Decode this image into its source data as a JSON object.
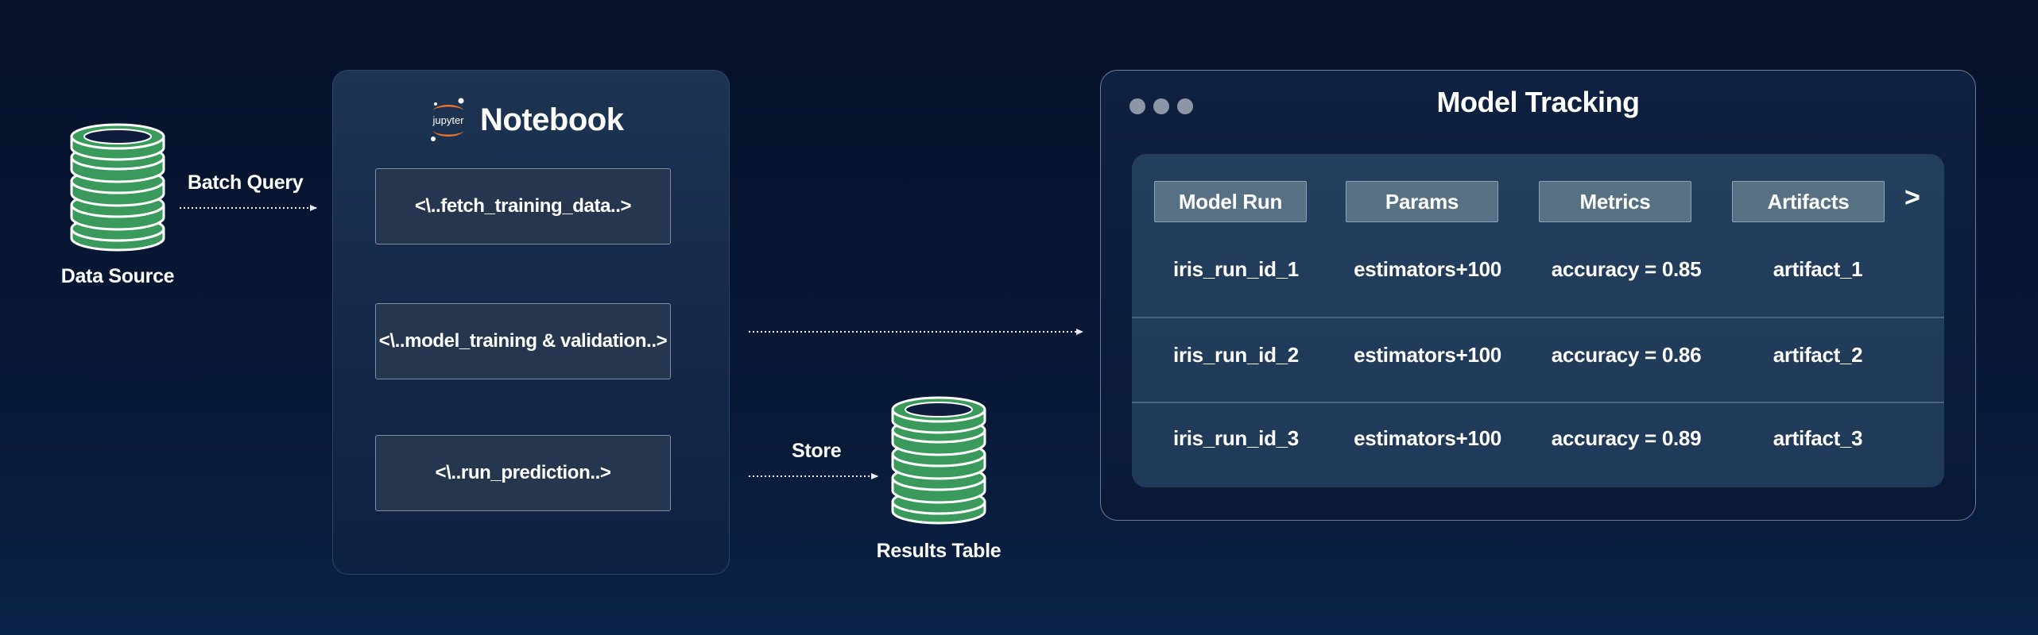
{
  "data_source": {
    "label": "Data Source"
  },
  "batch_query": {
    "label": "Batch Query"
  },
  "notebook": {
    "logo_text": "jupyter",
    "title": "Notebook",
    "steps": [
      "<\\..fetch_training_data..>",
      "<\\..model_training & validation..>",
      "<\\..run_prediction..>"
    ]
  },
  "store": {
    "label": "Store"
  },
  "results_table": {
    "label": "Results Table"
  },
  "model_tracking": {
    "title": "Model Tracking",
    "headers": [
      "Model Run",
      "Params",
      "Metrics",
      "Artifacts"
    ],
    "next_symbol": ">",
    "rows": [
      [
        "iris_run_id_1",
        "estimators+100",
        "accuracy = 0.85",
        "artifact_1"
      ],
      [
        "iris_run_id_2",
        "estimators+100",
        "accuracy = 0.86",
        "artifact_2"
      ],
      [
        "iris_run_id_3",
        "estimators+100",
        "accuracy = 0.89",
        "artifact_3"
      ]
    ]
  },
  "colors": {
    "database_green": "#3a9a5c",
    "database_outline": "#ffffff",
    "database_top": "#0e1d3c",
    "jupyter_orange": "#f37726",
    "connector": "#e8edf5"
  }
}
